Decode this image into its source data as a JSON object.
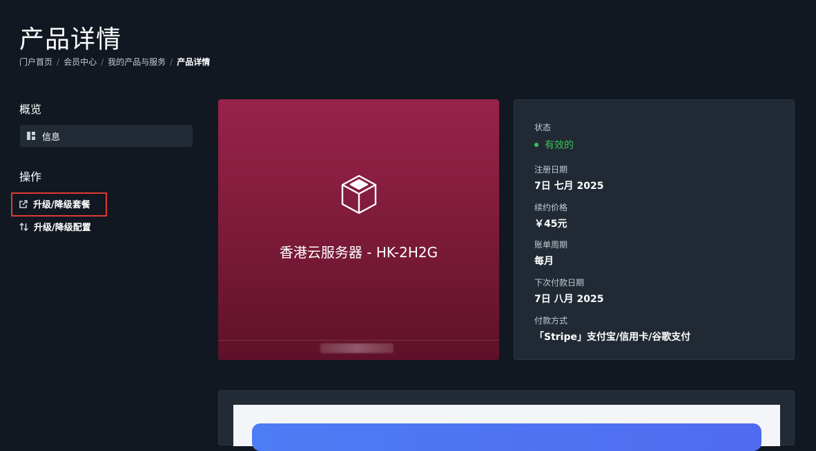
{
  "page": {
    "title": "产品详情"
  },
  "breadcrumb": {
    "items": [
      "门户首页",
      "会员中心",
      "我的产品与服务"
    ],
    "current": "产品详情",
    "separator": "/"
  },
  "sidebar": {
    "overview_heading": "概览",
    "info_item": "信息",
    "actions_heading": "操作",
    "actions": [
      {
        "label": "升级/降级套餐",
        "icon": "external-link-icon"
      },
      {
        "label": "升级/降级配置",
        "icon": "swap-vertical-icon"
      }
    ]
  },
  "product": {
    "name": "香港云服务器 - HK-2H2G",
    "icon": "cube-icon"
  },
  "details": {
    "status_label": "状态",
    "status_value": "有效的",
    "reg_date_label": "注册日期",
    "reg_date_value": "7日 七月 2025",
    "renew_price_label": "续约价格",
    "renew_price_value": "￥45元",
    "billing_cycle_label": "账单周期",
    "billing_cycle_value": "每月",
    "next_due_label": "下次付款日期",
    "next_due_value": "7日 八月 2025",
    "payment_method_label": "付款方式",
    "payment_method_value": "「Stripe」支付宝/信用卡/谷歌支付"
  },
  "colors": {
    "accent_status": "#3cc25a",
    "product_card": "#98234a",
    "highlight": "#e03a33"
  }
}
